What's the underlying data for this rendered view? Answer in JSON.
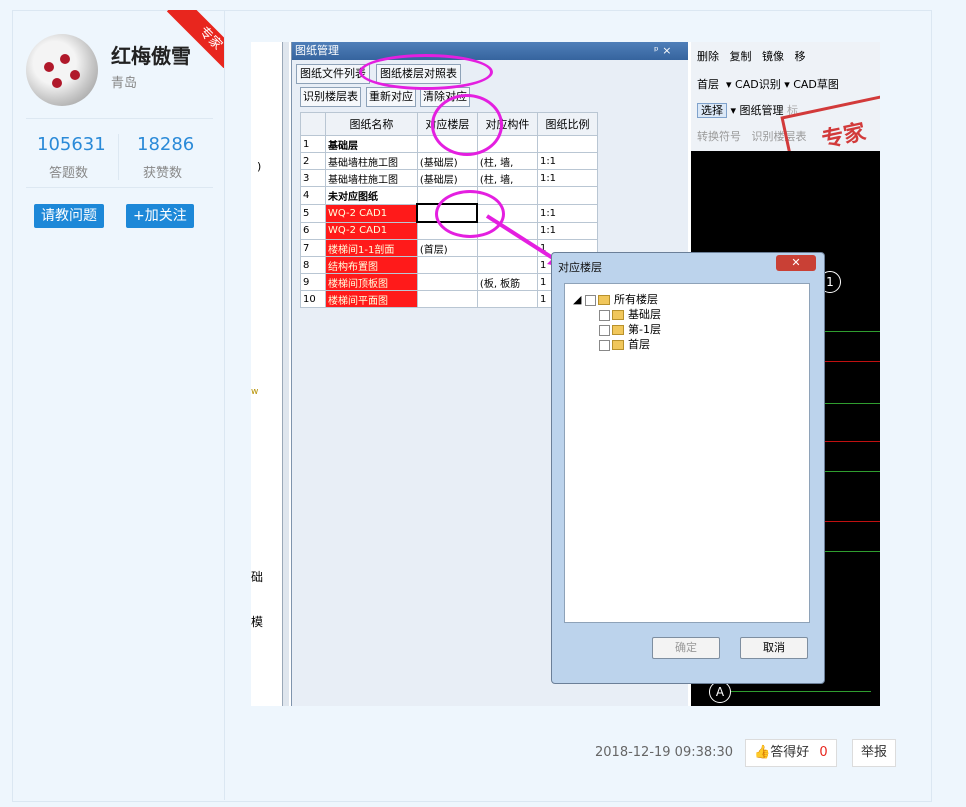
{
  "user": {
    "name": "红梅傲雪",
    "city": "青岛",
    "badge": "专家"
  },
  "stats": [
    {
      "value": "105631",
      "label": "答题数"
    },
    {
      "value": "18286",
      "label": "获赞数"
    }
  ],
  "buttons": {
    "ask": "请教问题",
    "follow": "+加关注"
  },
  "screenshot": {
    "panel_title": "图纸管理",
    "panel_pin": "ᵖ ×",
    "tabs": [
      "图纸文件列表",
      "图纸楼层对照表"
    ],
    "toolbar": [
      "识别楼层表",
      "重新对应",
      "清除对应"
    ],
    "table_headers": [
      "图纸名称",
      "对应楼层",
      "对应构件",
      "图纸比例"
    ],
    "rows": [
      {
        "num": "1",
        "name": "基础层",
        "floor": "",
        "comp": "",
        "scale": "",
        "group": true
      },
      {
        "num": "2",
        "name": "基础墙柱施工图",
        "floor": "(基础层)",
        "comp": "(柱, 墙,",
        "scale": "1:1"
      },
      {
        "num": "3",
        "name": "基础墙柱施工图",
        "floor": "(基础层)",
        "comp": "(柱, 墙,",
        "scale": "1:1"
      },
      {
        "num": "4",
        "name": "未对应图纸",
        "floor": "",
        "comp": "",
        "scale": "",
        "group": true
      },
      {
        "num": "5",
        "name": "WQ-2 CAD1",
        "floor": "",
        "comp": "",
        "scale": "1:1",
        "red": true
      },
      {
        "num": "6",
        "name": "WQ-2 CAD1",
        "floor": "",
        "comp": "",
        "scale": "1:1",
        "red": true
      },
      {
        "num": "7",
        "name": "楼梯间1-1剖面",
        "floor": "(首层)",
        "comp": "",
        "scale": "1",
        "red": true
      },
      {
        "num": "8",
        "name": "结构布置图",
        "floor": "",
        "comp": "",
        "scale": "1",
        "red": true
      },
      {
        "num": "9",
        "name": "楼梯间顶板图",
        "floor": "",
        "comp": "(板, 板筋",
        "scale": "1",
        "red": true
      },
      {
        "num": "10",
        "name": "楼梯间平面图",
        "floor": "",
        "comp": "",
        "scale": "1",
        "red": true
      }
    ],
    "right_toolbar": {
      "row1": [
        "删除",
        "复制",
        "镜像",
        "移"
      ],
      "row2": [
        "首层",
        "CAD识别",
        "CAD草图"
      ],
      "row3": [
        "选择",
        "图纸管理",
        "标"
      ],
      "row4": [
        "转换符号",
        "识别楼层表"
      ]
    },
    "stamp": "专家",
    "left_chars": [
      "础",
      "模"
    ],
    "axis_labels": [
      "1",
      "A"
    ],
    "dialog": {
      "title": "对应楼层",
      "tree": [
        "所有楼层",
        "基础层",
        "第-1层",
        "首层"
      ],
      "ok": "确定",
      "cancel": "取消"
    }
  },
  "footer": {
    "timestamp": "2018-12-19 09:38:30",
    "like_label": "答得好",
    "like_count": "0",
    "report": "举报"
  },
  "colors": {
    "accent": "#1d88d8",
    "badge": "#e8261e",
    "highlight": "#e41fe0"
  }
}
